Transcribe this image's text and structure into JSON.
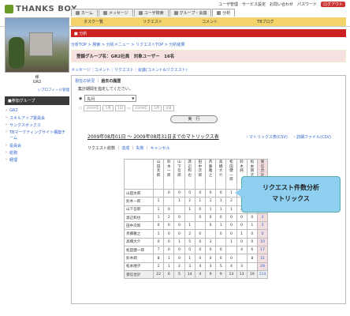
{
  "brand": {
    "logo_text": "THANKS BOX"
  },
  "utility": {
    "items": [
      "ユーザ管理",
      "サービス設定",
      "お問い合わせ",
      "パスワード",
      "ログアウト"
    ]
  },
  "nav": {
    "tabs": [
      {
        "label": "ホーム",
        "icon": "home-icon"
      },
      {
        "label": "メッセージ",
        "icon": "message-icon"
      },
      {
        "label": "ユーザ検索",
        "icon": "search-icon"
      },
      {
        "label": "グループ・会議",
        "icon": "group-icon"
      },
      {
        "label": "分析",
        "icon": "chart-icon"
      }
    ]
  },
  "subnav": {
    "items": [
      "タスク一覧",
      "リクエスト",
      "コメント",
      "TBブログ"
    ]
  },
  "sidebar": {
    "user_name": "様",
    "user_group": "GR2",
    "profile_link": "▷プロフィール管理",
    "group_header": "■参加グループ",
    "groups": [
      "GR2",
      "スキルアップ委員会",
      "サンクスボックス",
      "TBマーケティングサイト構築チーム",
      "役員会",
      "総務",
      "経理"
    ]
  },
  "page": {
    "header": "■ 分析",
    "breadcrumb": "分析TOP > 検索 > 分析メニュー > リクエストTOP > 分析結果",
    "title": "登録グループ名：GR2社員　対象ユーザー　16名",
    "tabs": "メッセージ｜コメント｜リクエスト｜会議(コメント&リクエスト)",
    "subtabs_current": "現在の状況",
    "subtabs_history": "過去の履歴",
    "period_label": "集計期間を指定してください。",
    "period_selected": "先月",
    "date_range": {
      "year1": "2009年",
      "month1": "5月",
      "day1": "1日",
      "sep": "～",
      "year2": "2009年",
      "month2": "5月",
      "day2": "8日"
    },
    "run_button": "実　行",
    "result_heading": "2009年08月01日 ～ 2009年08月31日までのマトリックス表",
    "csv_matrix": "・マトリックス表(CSV)",
    "csv_detail": "・詳細ファイル(CSV)",
    "result_tabs": {
      "total": "リクエスト総数",
      "done": "達成",
      "fail": "失敗",
      "cancel": "キャンセル"
    }
  },
  "matrix": {
    "columns": [
      "山田太郎",
      "鈴木一郎",
      "山下吾郎",
      "渡辺和也",
      "田中次郎",
      "斉藤雅之",
      "高橋大介",
      "松田健一郎",
      "鈴木純",
      "松本朋子",
      "受信合計"
    ],
    "rows": [
      {
        "name": "山田太郎",
        "cells": [
          "",
          "0",
          "0",
          "0",
          "0",
          "0",
          "0",
          "1",
          "0",
          "0",
          "1"
        ]
      },
      {
        "name": "鈴木一郎",
        "cells": [
          "1",
          "",
          "1",
          "2",
          "1",
          "1",
          "1",
          "2",
          "1",
          "3",
          "13"
        ]
      },
      {
        "name": "山下吾郎",
        "cells": [
          "1",
          "0",
          "",
          "1",
          "0",
          "1",
          "1",
          "1",
          "3",
          "4",
          "12"
        ]
      },
      {
        "name": "渡辺和也",
        "cells": [
          "1",
          "2",
          "0",
          "",
          "0",
          "0",
          "0",
          "0",
          "0",
          "0",
          "3"
        ]
      },
      {
        "name": "田中次郎",
        "cells": [
          "0",
          "0",
          "0",
          "1",
          "",
          "0",
          "1",
          "0",
          "0",
          "1",
          "3"
        ]
      },
      {
        "name": "斉藤雅之",
        "cells": [
          "1",
          "0",
          "0",
          "2",
          "0",
          "",
          "0",
          "0",
          "1",
          "0",
          "4"
        ]
      },
      {
        "name": "高橋大介",
        "cells": [
          "0",
          "0",
          "1",
          "5",
          "0",
          "3",
          "",
          "1",
          "0",
          "0",
          "10"
        ]
      },
      {
        "name": "松田健一郎",
        "cells": [
          "7",
          "0",
          "0",
          "0",
          "0",
          "0",
          "0",
          "",
          "4",
          "6",
          "17"
        ]
      },
      {
        "name": "鈴木純",
        "cells": [
          "8",
          "1",
          "0",
          "1",
          "0",
          "0",
          "0",
          "0",
          "",
          "8",
          "31"
        ]
      },
      {
        "name": "松本朋子",
        "cells": [
          "2",
          "1",
          "2",
          "3",
          "4",
          "3",
          "5",
          "4",
          "3",
          "",
          "29"
        ]
      }
    ],
    "total": {
      "name": "受信合計",
      "cells": [
        "22",
        "6",
        "5",
        "14",
        "4",
        "9",
        "9",
        "13",
        "13",
        "19",
        "114"
      ]
    }
  },
  "callout": {
    "line1": "リクエスト件数分析",
    "line2": "マトリックス"
  }
}
